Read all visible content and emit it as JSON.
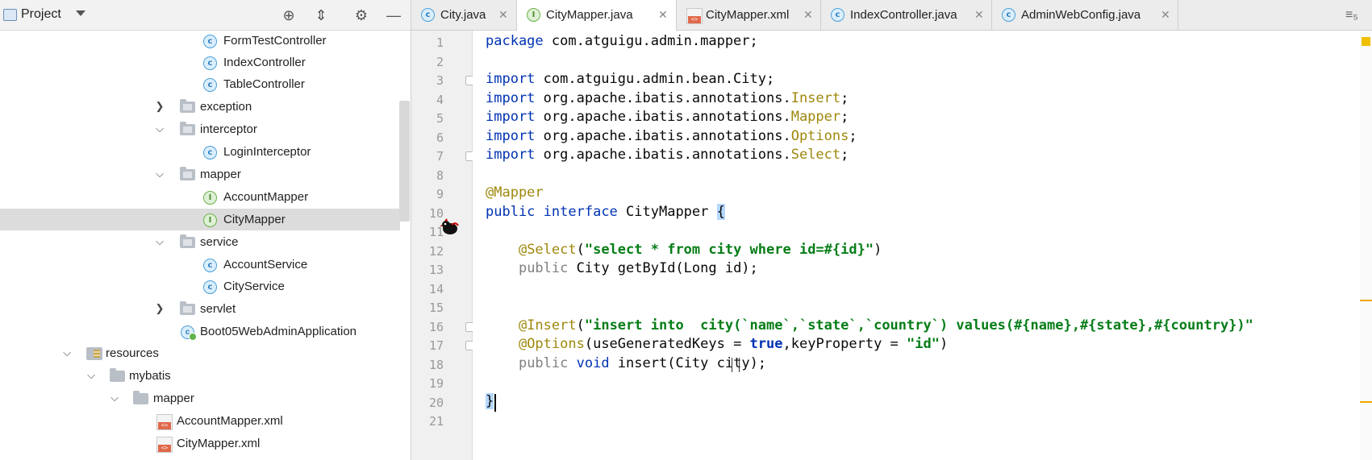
{
  "project": {
    "title": "Project",
    "tree": [
      {
        "label": "FormTestController",
        "icon": "class-icon"
      },
      {
        "label": "IndexController",
        "icon": "class-icon"
      },
      {
        "label": "TableController",
        "icon": "class-icon"
      },
      {
        "label": "exception",
        "icon": "package-folder-icon"
      },
      {
        "label": "interceptor",
        "icon": "package-folder-icon"
      },
      {
        "label": "LoginInterceptor",
        "icon": "class-icon"
      },
      {
        "label": "mapper",
        "icon": "package-folder-icon"
      },
      {
        "label": "AccountMapper",
        "icon": "interface-icon"
      },
      {
        "label": "CityMapper",
        "icon": "interface-icon"
      },
      {
        "label": "service",
        "icon": "package-folder-icon"
      },
      {
        "label": "AccountService",
        "icon": "class-icon"
      },
      {
        "label": "CityService",
        "icon": "class-icon"
      },
      {
        "label": "servlet",
        "icon": "package-folder-icon"
      },
      {
        "label": "Boot05WebAdminApplication",
        "icon": "spring-boot-app-icon"
      },
      {
        "label": "resources",
        "icon": "resources-folder-icon"
      },
      {
        "label": "mybatis",
        "icon": "folder-icon"
      },
      {
        "label": "mapper",
        "icon": "folder-icon"
      },
      {
        "label": "AccountMapper.xml",
        "icon": "xml-file-icon"
      },
      {
        "label": "CityMapper.xml",
        "icon": "xml-file-icon"
      }
    ],
    "selected": "CityMapper"
  },
  "tabs": [
    {
      "label": "City.java",
      "icon": "class-icon"
    },
    {
      "label": "CityMapper.java",
      "icon": "interface-icon",
      "active": true
    },
    {
      "label": "CityMapper.xml",
      "icon": "xml-file-icon"
    },
    {
      "label": "IndexController.java",
      "icon": "class-icon"
    },
    {
      "label": "AdminWebConfig.java",
      "icon": "class-icon"
    }
  ],
  "tab_overflow": "≡₅",
  "editor": {
    "line_numbers": [
      "1",
      "2",
      "3",
      "4",
      "5",
      "6",
      "7",
      "8",
      "9",
      "10",
      "11",
      "12",
      "13",
      "14",
      "15",
      "16",
      "17",
      "18",
      "19",
      "20",
      "21"
    ],
    "lines": {
      "l1_kw": "package",
      "l1_rest": " com.atguigu.admin.mapper;",
      "l3_kw": "import",
      "l3_rest": " com.atguigu.admin.bean.City;",
      "l4_kw": "import",
      "l4_pkg": " org.apache.ibatis.annotations.",
      "l4_ann": "Insert",
      "l5_kw": "import",
      "l5_pkg": " org.apache.ibatis.annotations.",
      "l5_ann": "Mapper",
      "l6_kw": "import",
      "l6_pkg": " org.apache.ibatis.annotations.",
      "l6_ann": "Options",
      "l7_kw": "import",
      "l7_pkg": " org.apache.ibatis.annotations.",
      "l7_ann": "Select",
      "semi": ";",
      "l9_ann": "@Mapper",
      "l10_kw1": "public",
      "l10_kw2": "interface",
      "l10_name": " CityMapper ",
      "l10_brace": "{",
      "l12_ann": "@Select",
      "l12_str": "\"select * from city where id=#{id}\"",
      "l13_kw": "public",
      "l13_rest": " City getById(Long id);",
      "l16_ann": "@Insert",
      "l16_str": "\"insert into  city(`name`,`state`,`country`) values(#{name},#{state},#{country})\"",
      "l17_ann": "@Options",
      "l17_a": "(useGeneratedKeys = ",
      "l17_true": "true",
      "l17_b": ",keyProperty = ",
      "l17_str": "\"id\"",
      "l17_c": ")",
      "l18_kw1": "public",
      "l18_kw2": "void",
      "l18_rest": " insert(City city);",
      "l20_brace": "}"
    }
  }
}
